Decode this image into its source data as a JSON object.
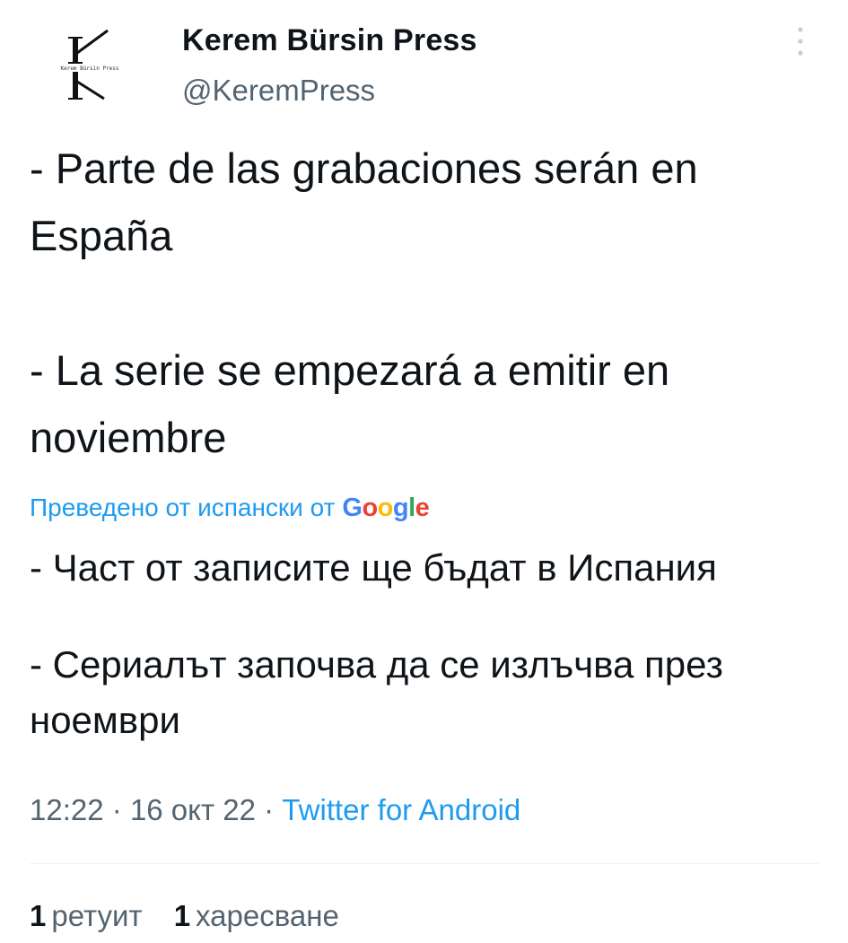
{
  "author": {
    "display_name": "Kerem Bürsin Press",
    "handle": "@KeremPress",
    "avatar_small_text": "Kerem Bürsin Press"
  },
  "tweet": {
    "lines": [
      "- Parte de las grabaciones serán en España",
      "- La serie se empezará a emitir en noviembre"
    ]
  },
  "translation": {
    "label": "Преведено от испански от",
    "provider": {
      "letters": [
        "G",
        "o",
        "o",
        "g",
        "l",
        "e"
      ],
      "colors": [
        "#4285f4",
        "#ea4335",
        "#fbbc05",
        "#4285f4",
        "#34a853",
        "#ea4335"
      ]
    },
    "lines": [
      "- Част от записите ще бъдат в Испания",
      "- Сериалът започва да се излъчва през ноември"
    ]
  },
  "meta": {
    "time": "12:22",
    "separator": "·",
    "date": "16 окт 22",
    "source": "Twitter for Android"
  },
  "stats": {
    "retweets_count": "1",
    "retweets_label": "ретуит",
    "likes_count": "1",
    "likes_label": "харесване"
  },
  "icons": {
    "more": "more-vertical-icon",
    "avatar": "k-monogram-logo"
  },
  "colors": {
    "accent": "#1d9bf0",
    "text": "#0f1419",
    "secondary": "#536471",
    "divider": "#eff3f4"
  }
}
